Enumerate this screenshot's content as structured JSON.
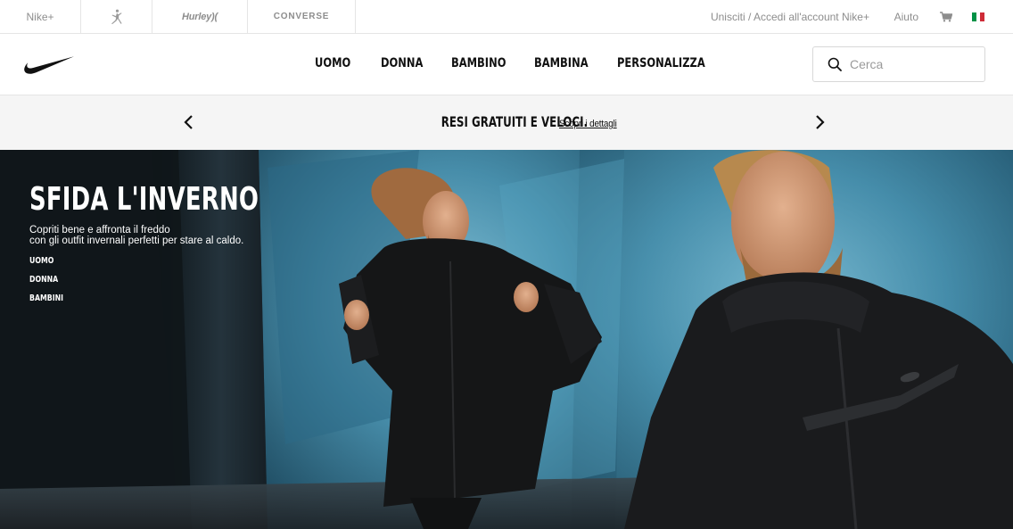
{
  "topbar": {
    "brands": {
      "nikeplus": "Nike+",
      "jordan": "jordan-jumpman-icon",
      "hurley": "Hurley)(",
      "converse": "CONVERSE"
    },
    "account_link": "Unisciti / Accedi all'account Nike+",
    "help_link": "Aiuto",
    "cart_icon": "cart-icon",
    "country_flag": "italy-flag-icon",
    "flag_colors": [
      "#009246",
      "#ffffff",
      "#ce2b37"
    ]
  },
  "nav": {
    "logo": "nike-swoosh-icon",
    "items": [
      "UOMO",
      "DONNA",
      "BAMBINO",
      "BAMBINA",
      "PERSONALIZZA"
    ],
    "search_placeholder": "Cerca"
  },
  "promo": {
    "headline": "RESI GRATUITI E VELOCI.",
    "link": "Scopri i dettagli",
    "prev_icon": "chevron-left-icon",
    "next_icon": "chevron-right-icon"
  },
  "hero": {
    "title": "SFIDA L'INVERNO",
    "description_line1": "Copriti bene e affronta il freddo",
    "description_line2": "con gli outfit invernali perfetti per stare al caldo.",
    "links": [
      "UOMO",
      "DONNA",
      "BAMBINI"
    ]
  }
}
